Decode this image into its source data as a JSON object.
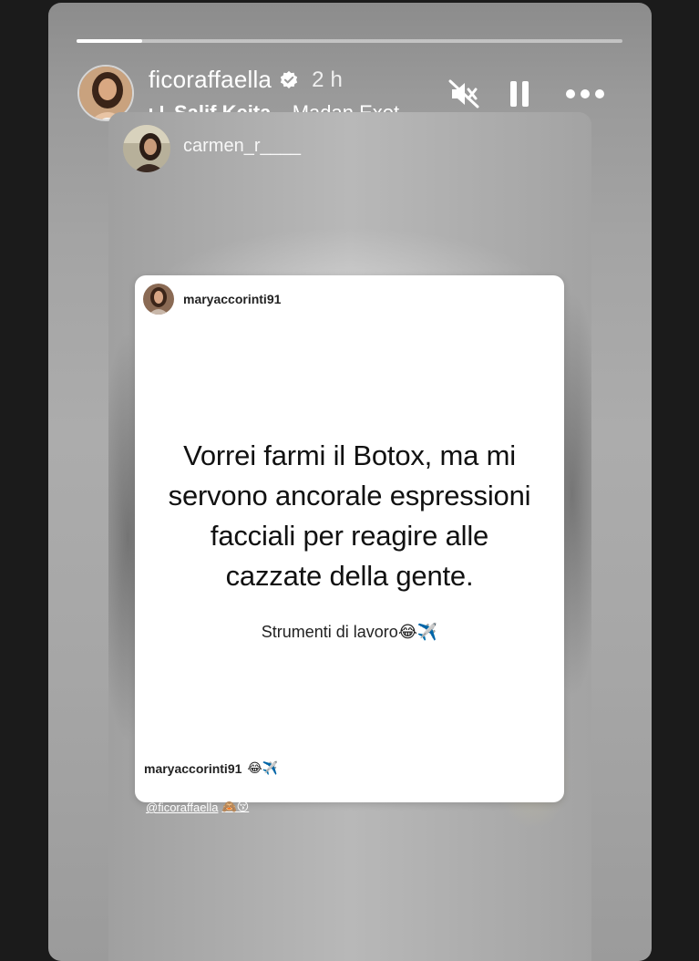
{
  "story": {
    "progress": 0.12,
    "author": {
      "username": "ficoraffaella",
      "verified": true,
      "time_ago": "2 h",
      "avatar_icon": "avatar-photo-icon"
    },
    "music": {
      "artist": "Salif Keita",
      "separator": "·",
      "track": "Madan Exot"
    },
    "controls": {
      "mute_icon": "speaker-muted-icon",
      "pause_icon": "pause-icon",
      "more_icon": "more-horizontal-icon"
    }
  },
  "repost": {
    "username": "carmen_r____",
    "avatar_icon": "avatar-photo-icon",
    "mention": "@ficoraffaella",
    "mention_emoji": "🙈😚"
  },
  "card": {
    "username": "maryaccorinti91",
    "quote_lines": [
      "Vorrei farmi il Botox, ma mi",
      "servono ancorale espressioni",
      "facciali per reagire alle",
      "cazzate della gente."
    ],
    "caption": "Strumenti di lavoro",
    "caption_emoji": "😂✈️",
    "footer_username": "maryaccorinti91",
    "footer_emoji": "😂✈️"
  },
  "colors": {
    "background": "#1b1b1b",
    "card": "#ffffff",
    "text_dark": "#111111",
    "verified_badge": "#ffffff"
  }
}
